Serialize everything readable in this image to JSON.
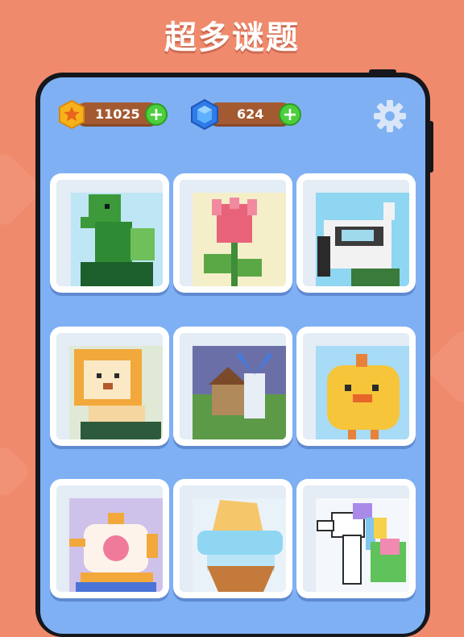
{
  "headline": "超多谜题",
  "resources": {
    "coins": "11025",
    "gems": "624"
  },
  "icons": {
    "coin": "star-badge-icon",
    "gem": "blue-gem-icon",
    "add": "plus-icon",
    "settings": "gear-icon"
  },
  "puzzles": [
    {
      "subject": "green dinosaur"
    },
    {
      "subject": "pink tulip"
    },
    {
      "subject": "astronaut helmet"
    },
    {
      "subject": "lion cub"
    },
    {
      "subject": "windmill house"
    },
    {
      "subject": "yellow chick"
    },
    {
      "subject": "teapot with rose"
    },
    {
      "subject": "cupcake"
    },
    {
      "subject": "rainbow unicorn"
    }
  ],
  "colors": {
    "background": "#f08a6c",
    "screen": "#7fb0f4",
    "pill": "#a45a31",
    "plus": "#4ccf3c"
  }
}
